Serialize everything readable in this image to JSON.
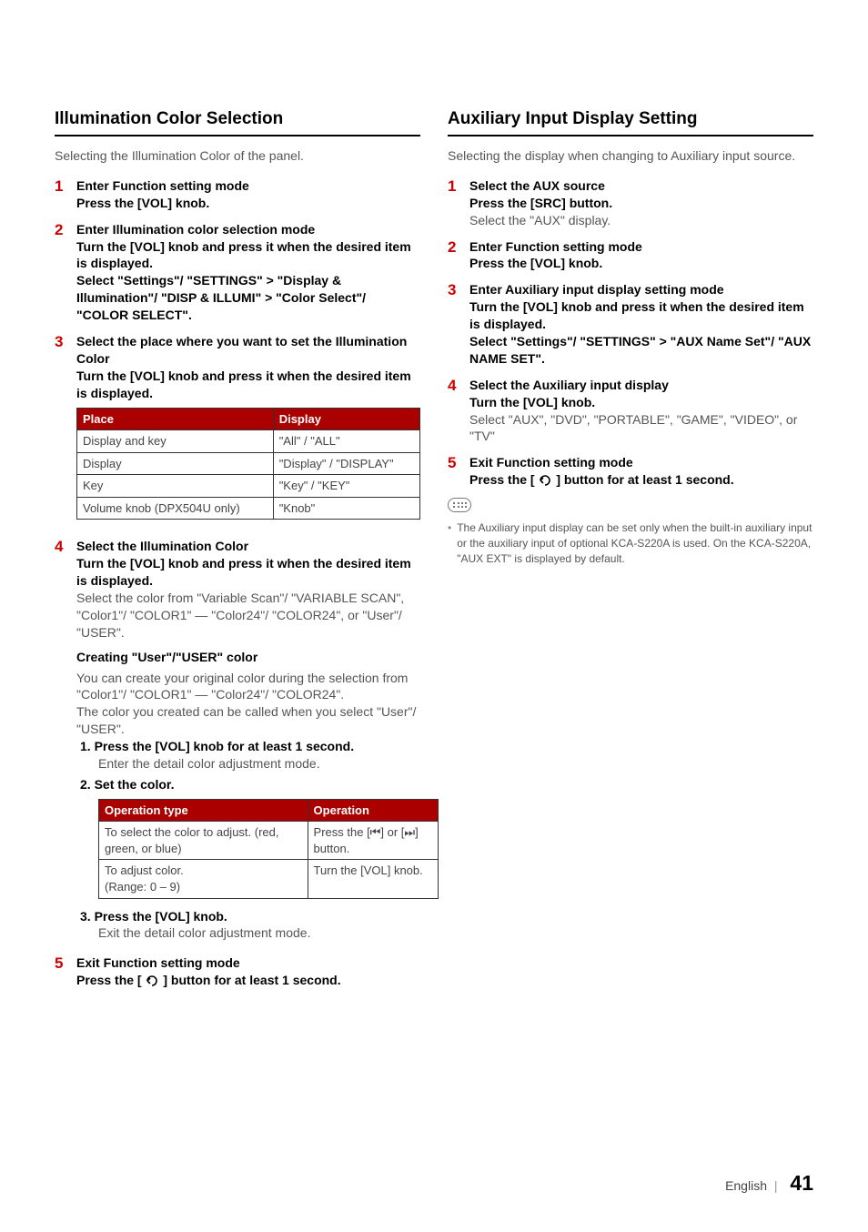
{
  "left": {
    "title": "Illumination Color Selection",
    "intro": "Selecting the Illumination Color of the panel.",
    "steps": [
      {
        "num": "1",
        "lines": [
          {
            "bold": true,
            "text": "Enter Function setting mode"
          },
          {
            "bold": true,
            "text": "Press the [VOL] knob."
          }
        ]
      },
      {
        "num": "2",
        "lines": [
          {
            "bold": true,
            "text": "Enter Illumination color selection mode"
          },
          {
            "bold": true,
            "text": "Turn the [VOL] knob and press it when the desired item is displayed."
          },
          {
            "bold": true,
            "text": "Select \"Settings\"/ \"SETTINGS\" > \"Display & Illumination\"/ \"DISP & ILLUMI\" > \"Color Select\"/ \"COLOR SELECT\"."
          }
        ]
      },
      {
        "num": "3",
        "lines": [
          {
            "bold": true,
            "text": "Select the place where you want to set the Illumination Color"
          },
          {
            "bold": true,
            "text": "Turn the [VOL] knob and press it when the desired item is displayed."
          }
        ],
        "table": {
          "headers": [
            "Place",
            "Display"
          ],
          "rows": [
            [
              "Display and key",
              "\"All\" / \"ALL\""
            ],
            [
              "Display",
              "\"Display\" / \"DISPLAY\""
            ],
            [
              "Key",
              "\"Key\" / \"KEY\""
            ],
            [
              "Volume knob (DPX504U only)",
              "\"Knob\""
            ]
          ]
        }
      },
      {
        "num": "4",
        "lines": [
          {
            "bold": true,
            "text": "Select the Illumination Color"
          },
          {
            "bold": true,
            "text": "Turn the [VOL] knob and press it when the desired item is displayed."
          },
          {
            "bold": false,
            "text": "Select the color from \"Variable Scan\"/ \"VARIABLE SCAN\", \"Color1\"/ \"COLOR1\" — \"Color24\"/ \"COLOR24\", or \"User\"/ \"USER\"."
          }
        ],
        "subhead": "Creating \"User\"/\"USER\" color",
        "subbody": [
          "You can create your original color during the selection from \"Color1\"/ \"COLOR1\" — \"Color24\"/ \"COLOR24\".",
          "The color you created can be called when you select \"User\"/ \"USER\"."
        ],
        "substeps": [
          {
            "num": "1.",
            "bold": "Press the [VOL] knob for at least 1 second.",
            "body": "Enter the detail color adjustment mode."
          },
          {
            "num": "2.",
            "bold": "Set the color.",
            "table": {
              "headers": [
                "Operation type",
                "Operation"
              ],
              "rows": [
                [
                  "To select the color to adjust. (red, green, or blue)",
                  "Press the [⏮] or [⏭] button."
                ],
                [
                  "To adjust color.\n(Range: 0 – 9)",
                  "Turn the [VOL] knob."
                ]
              ]
            }
          },
          {
            "num": "3.",
            "bold": "Press the [VOL] knob.",
            "body": "Exit the detail color adjustment mode."
          }
        ]
      },
      {
        "num": "5",
        "lines": [
          {
            "bold": true,
            "text": "Exit Function setting mode"
          },
          {
            "bold": true,
            "text": "Press the [↶] button for at least 1 second."
          }
        ]
      }
    ]
  },
  "right": {
    "title": "Auxiliary Input Display Setting",
    "intro": "Selecting the display when changing to Auxiliary input source.",
    "steps": [
      {
        "num": "1",
        "lines": [
          {
            "bold": true,
            "text": "Select the AUX source"
          },
          {
            "bold": true,
            "text": "Press the [SRC] button."
          },
          {
            "bold": false,
            "text": "Select the \"AUX\" display."
          }
        ]
      },
      {
        "num": "2",
        "lines": [
          {
            "bold": true,
            "text": "Enter Function setting mode"
          },
          {
            "bold": true,
            "text": "Press the [VOL] knob."
          }
        ]
      },
      {
        "num": "3",
        "lines": [
          {
            "bold": true,
            "text": "Enter Auxiliary input display setting mode"
          },
          {
            "bold": true,
            "text": "Turn the [VOL] knob and press it when the desired item is displayed."
          },
          {
            "bold": true,
            "text": "Select \"Settings\"/ \"SETTINGS\" > \"AUX Name Set\"/ \"AUX NAME SET\"."
          }
        ]
      },
      {
        "num": "4",
        "lines": [
          {
            "bold": true,
            "text": "Select the Auxiliary input display"
          },
          {
            "bold": true,
            "text": "Turn the [VOL] knob."
          },
          {
            "bold": false,
            "text": "Select \"AUX\", \"DVD\", \"PORTABLE\", \"GAME\", \"VIDEO\", or \"TV\""
          }
        ]
      },
      {
        "num": "5",
        "lines": [
          {
            "bold": true,
            "text": "Exit Function setting mode"
          },
          {
            "bold": true,
            "text": "Press the [↶] button for at least 1 second."
          }
        ]
      }
    ],
    "note": "The Auxiliary input display can be set only when the built-in auxiliary input or the auxiliary input of optional KCA-S220A is used. On the KCA-S220A, \"AUX EXT\" is displayed by default."
  },
  "footer": {
    "lang": "English",
    "page": "41"
  }
}
